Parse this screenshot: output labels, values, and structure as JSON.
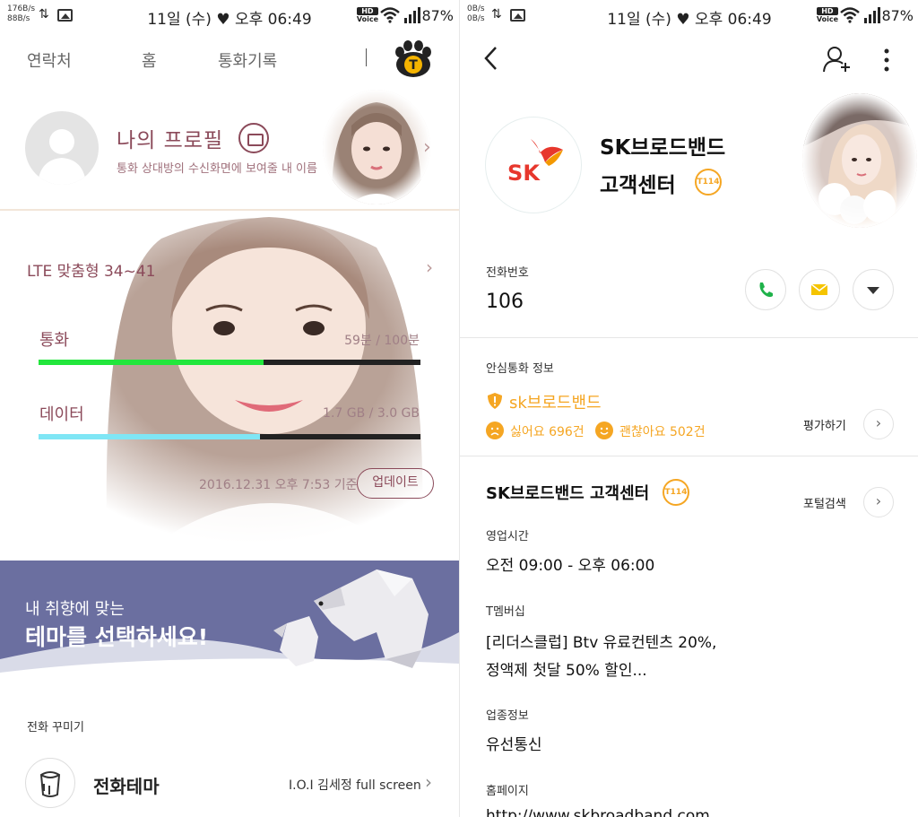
{
  "status": {
    "left": {
      "net_up": "176B/s",
      "net_down": "88B/s",
      "clock": "11일 (수) ♥ 오후 06:49",
      "battery": "87%"
    },
    "right": {
      "net_up": "0B/s",
      "net_down": "0B/s",
      "clock": "11일 (수) ♥ 오후 06:49",
      "battery": "87%"
    },
    "hd_label": "HD",
    "voice_label": "Voice"
  },
  "left": {
    "nav": {
      "contacts": "연락처",
      "home": "홈",
      "call_log": "통화기록",
      "logo_letter": "T"
    },
    "profile": {
      "title": "나의 프로필",
      "subtitle": "통화 상대방의 수신화면에 보여줄 내 이름"
    },
    "usage": {
      "plan": "LTE 맞춤형 34~41",
      "call": {
        "label": "통화",
        "value": "59분 / 100분",
        "fill": 0.59,
        "color": "#22e63c"
      },
      "data": {
        "label": "데이터",
        "value": "1.7 GB / 3.0 GB",
        "fill": 0.58,
        "color": "#7fe6f5"
      },
      "updated": "2016.12.31  오후 7:53  기준",
      "update_button": "업데이트"
    },
    "banner": {
      "line1": "내 취향에 맞는",
      "line2": "테마를 선택하세요!"
    },
    "decorate": {
      "section": "전화 꾸미기",
      "theme_title": "전화테마",
      "theme_value": "I.O.I 김세정 full screen"
    }
  },
  "right": {
    "contact": {
      "name_line1": "SK브로드밴드",
      "name_line2": "고객센터",
      "badge": "T114",
      "logo": "SK"
    },
    "phone": {
      "label": "전화번호",
      "number": "106"
    },
    "safe": {
      "label": "안심통화 정보",
      "name": "sk브로드밴드",
      "dislike": "싫어요 696건",
      "like": "괜찮아요 502건",
      "rate_button": "평가하기"
    },
    "business": {
      "title": "SK브로드밴드 고객센터",
      "portal_button": "포털검색",
      "hours_label": "영업시간",
      "hours": "오전 09:00 - 오후 06:00",
      "membership_label": "T멤버십",
      "membership_line1": "[리더스클럽] Btv 유료컨텐츠 20%,",
      "membership_line2": "정액제 첫달 50% 할인...",
      "category_label": "업종정보",
      "category": "유선통신",
      "homepage_label": "홈페이지",
      "homepage": "http://www.skbroadband.com"
    },
    "icons": {
      "back": "back-arrow-icon",
      "add": "add-contact-icon",
      "more": "more-vertical-icon",
      "call": "phone-icon",
      "message": "message-icon",
      "expand": "chevron-down-icon"
    }
  }
}
